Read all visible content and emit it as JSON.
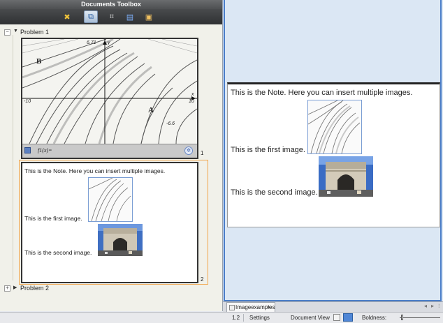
{
  "toolbox": {
    "title": "Documents Toolbox",
    "tools": [
      {
        "icon": "calculator-tools-icon",
        "glyph": "✖",
        "active": false
      },
      {
        "icon": "page-sorter-icon",
        "glyph": "⧉",
        "active": true
      },
      {
        "icon": "variables-icon",
        "glyph": "⌗",
        "active": false
      },
      {
        "icon": "library-icon",
        "glyph": "📖",
        "active": false
      },
      {
        "icon": "content-explorer-icon",
        "glyph": "▣",
        "active": false
      }
    ]
  },
  "tree": {
    "problem1": "Problem 1",
    "problem2": "Problem 2",
    "expand_open": "−",
    "expand_closed": "+"
  },
  "page1": {
    "number": "1",
    "graph": {
      "y_max_label": "6.71",
      "y_axis_label": "y",
      "x_min_label": "-10",
      "x_max_label": "10",
      "x_axis_label": "x",
      "y_min_label": "-6.6",
      "label_B": "B",
      "label_A": "A"
    },
    "entry_line": "f1(x)="
  },
  "page2": {
    "number": "2",
    "note_intro": "This is the Note.  Here you can insert multiple images.",
    "first_image_caption": "This is the first image.",
    "second_image_caption": "This is the second image."
  },
  "right_doc": {
    "note_intro": "This is the Note.  Here you can insert multiple images.",
    "first_image_caption": "This is the first image.",
    "second_image_caption": "This is the second image."
  },
  "tabs": [
    {
      "label": "Imageexamples",
      "close": "×"
    }
  ],
  "tab_nav": {
    "prev": "◂",
    "next": "▸",
    "menu": "⁝"
  },
  "status_bar": {
    "page_indicator": "1.2",
    "settings": "Settings",
    "document_view": "Document View",
    "boldness": "Boldness:"
  },
  "colors": {
    "toolbar_bg": "#3a3c3e",
    "accent_border": "#4a7dc8",
    "selection_outline": "#f1a54a",
    "right_bg": "#dbe7f4"
  }
}
